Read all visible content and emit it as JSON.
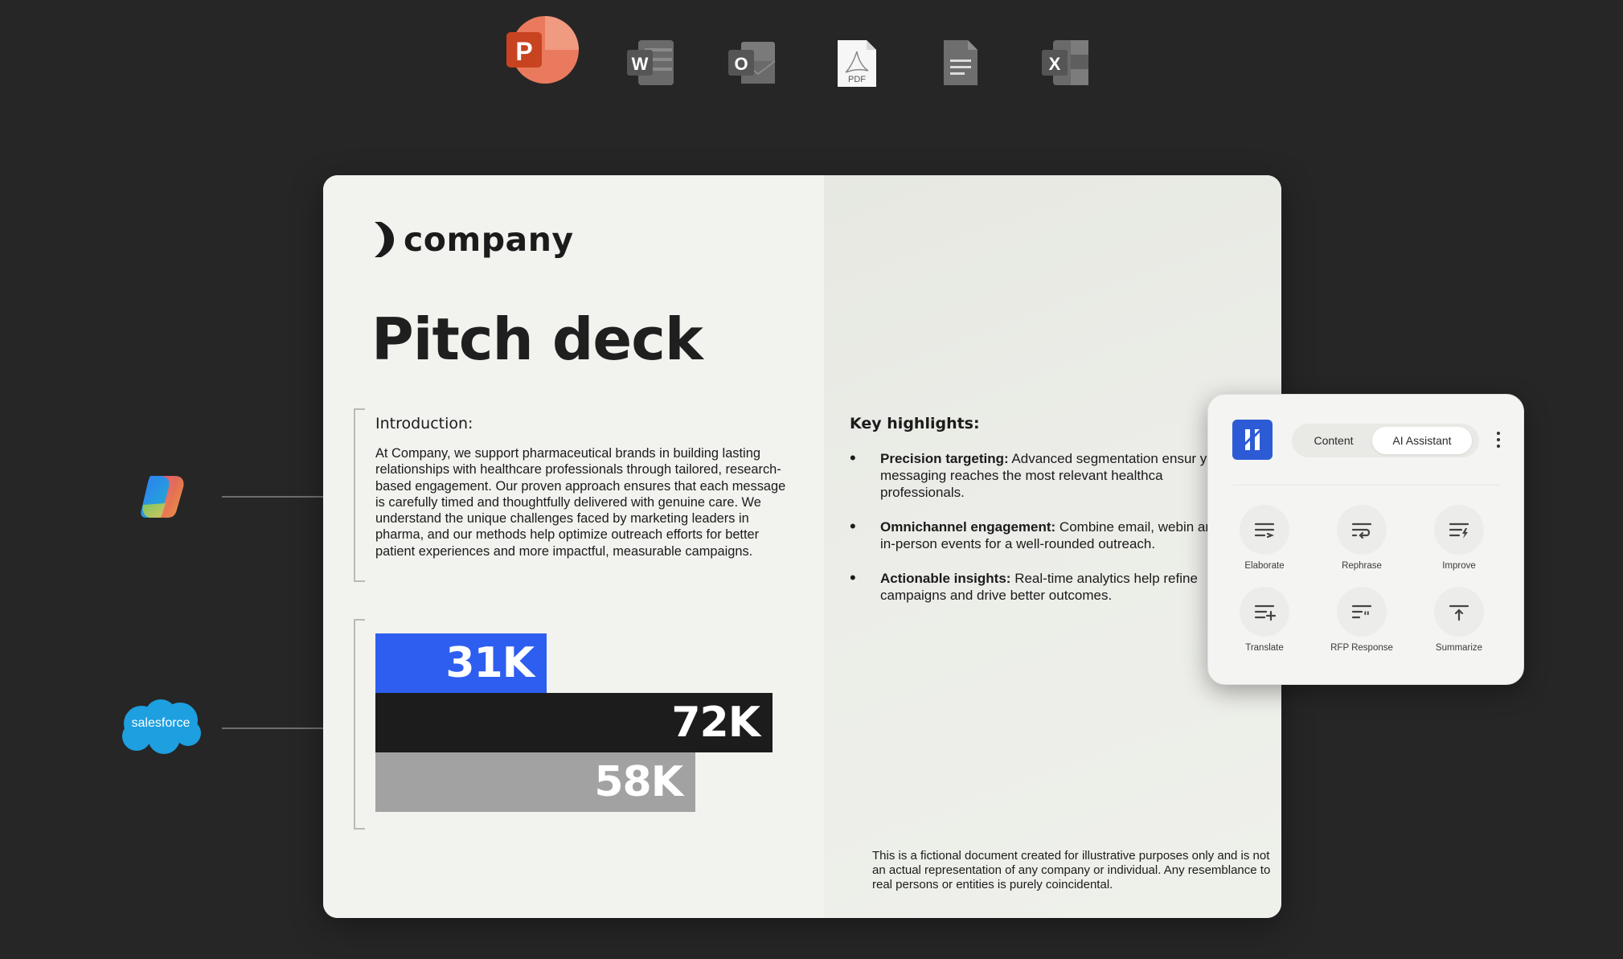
{
  "app_icons": [
    {
      "name": "powerpoint-icon",
      "letter": "P",
      "color": "#d24726"
    },
    {
      "name": "word-icon",
      "letter": "W",
      "color": "#6e6e6e"
    },
    {
      "name": "outlook-icon",
      "letter": "O",
      "color": "#6e6e6e"
    },
    {
      "name": "pdf-icon",
      "letter": "PDF",
      "color": "#ffffff"
    },
    {
      "name": "google-docs-icon",
      "letter": "",
      "color": "#6e6e6e"
    },
    {
      "name": "excel-icon",
      "letter": "X",
      "color": "#6e6e6e"
    }
  ],
  "integrations": {
    "copilot_icon": "copilot-icon",
    "salesforce_label": "salesforce"
  },
  "document": {
    "logo_text": "company",
    "title": "Pitch deck",
    "intro": {
      "heading": "Introduction:",
      "body": "At Company, we support pharmaceutical brands in building lasting relationships with healthcare professionals through tailored, research-based engagement. Our proven approach ensures that each message is carefully timed and thoughtfully delivered with genuine care. We understand the unique challenges faced by marketing leaders in pharma, and our methods help optimize outreach efforts for better patient experiences and more impactful, measurable campaigns."
    },
    "stats": [
      {
        "label": "31K",
        "value": 31000,
        "color": "#2e5ef0"
      },
      {
        "label": "72K",
        "value": 72000,
        "color": "#1c1c1c"
      },
      {
        "label": "58K",
        "value": 58000,
        "color": "#a2a2a2"
      }
    ],
    "highlights": {
      "heading": "Key highlights:",
      "items": [
        {
          "bold": "Precision targeting:",
          "text": " Advanced segmentation ensur your messaging reaches the most relevant healthca professionals."
        },
        {
          "bold": "Omnichannel engagement:",
          "text": " Combine email, webin and in-person events for a well-rounded outreach."
        },
        {
          "bold": "Actionable insights:",
          "text": " Real-time analytics help refine campaigns and drive better outcomes."
        }
      ]
    },
    "disclaimer": "This is a fictional document created for illustrative purposes only and is not an actual representation of any company or individual. Any resemblance to real persons or entities is purely coincidental."
  },
  "panel": {
    "tabs": {
      "content": "Content",
      "ai_assistant": "AI Assistant",
      "active": "AI Assistant"
    },
    "accent": "#2d5bd6",
    "actions": [
      {
        "label": "Elaborate",
        "icon": "elaborate-icon"
      },
      {
        "label": "Rephrase",
        "icon": "rephrase-icon"
      },
      {
        "label": "Improve",
        "icon": "improve-icon"
      },
      {
        "label": "Translate",
        "icon": "translate-icon"
      },
      {
        "label": "RFP Response",
        "icon": "rfp-response-icon"
      },
      {
        "label": "Summarize",
        "icon": "summarize-icon"
      }
    ]
  }
}
